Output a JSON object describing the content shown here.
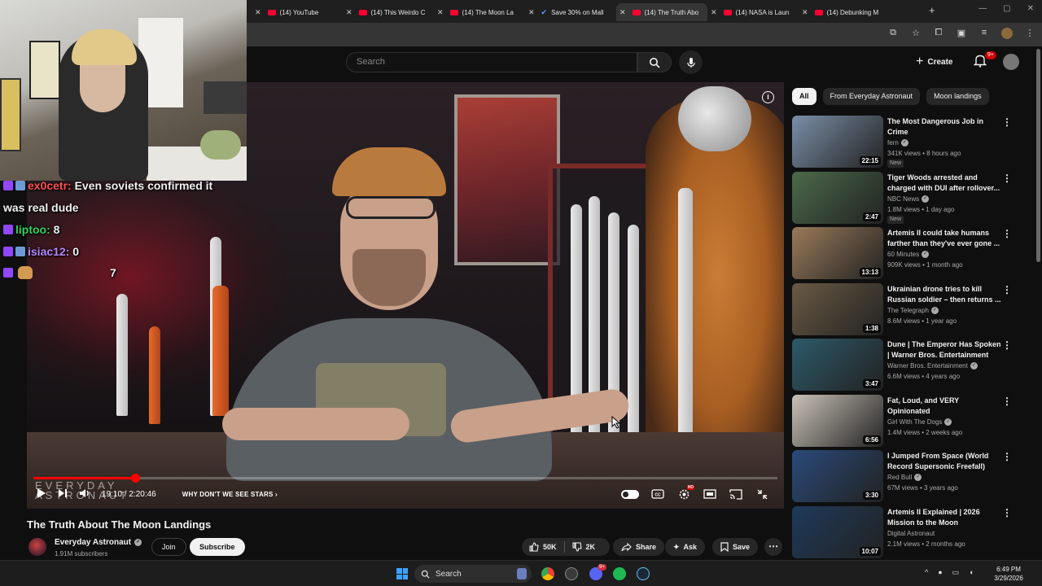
{
  "browser": {
    "tabs": [
      {
        "label": "(14) YouTube",
        "icon": "youtube-favicon",
        "active": false
      },
      {
        "label": "(14) This Weirdo C",
        "icon": "youtube-favicon",
        "active": false
      },
      {
        "label": "(14) The Moon La",
        "icon": "youtube-favicon",
        "active": false
      },
      {
        "label": "Save 30% on Mall",
        "icon": "steam-favicon",
        "active": false
      },
      {
        "label": "(14) The Truth Abo",
        "icon": "youtube-favicon",
        "active": true
      },
      {
        "label": "(14) NASA is Laun",
        "icon": "youtube-favicon",
        "active": false
      },
      {
        "label": "(14) Debunking M",
        "icon": "youtube-favicon",
        "active": false
      }
    ]
  },
  "youtube": {
    "search_placeholder": "Search",
    "create_label": "Create",
    "notification_count": "9+"
  },
  "stream_chat": [
    {
      "user": "ex0cetr:",
      "message": "Even soviets confirmed it",
      "continuation": "was real dude",
      "color": "#ff4f4f"
    },
    {
      "user": "liptoo:",
      "message": "8",
      "color": "#2fd25b"
    },
    {
      "user": "isiac12:",
      "message": "0",
      "color": "#b589ff"
    },
    {
      "user": "",
      "message": "7",
      "emote": "emote-face"
    }
  ],
  "player": {
    "watermark_line1": "EVERYDAY",
    "watermark_line2": "ASTRONAUT",
    "time": "19:10 / 2:20:46",
    "chapter": "WHY DON'T WE SEE STARS",
    "progress_fraction": 0.137,
    "settings_badge": "HD"
  },
  "video": {
    "title": "The Truth About The Moon Landings",
    "channel": "Everyday Astronaut",
    "subscribers": "1.91M subscribers",
    "join_label": "Join",
    "subscribe_label": "Subscribe",
    "likes": "50K",
    "dislikes": "2K",
    "share_label": "Share",
    "ask_label": "Ask",
    "save_label": "Save"
  },
  "sidebar": {
    "chips": [
      "All",
      "From Everyday Astronaut",
      "Moon landings"
    ],
    "items": [
      {
        "title": "The Most Dangerous Job in Crime",
        "channel": "fern",
        "verified": true,
        "meta": "341K views • 8 hours ago",
        "badge": "New",
        "duration": "22:15",
        "thumb": "#7a8fa8"
      },
      {
        "title": "Tiger Woods arrested and charged with DUI after rollover...",
        "channel": "NBC News",
        "verified": true,
        "meta": "1.8M views • 1 day ago",
        "badge": "New",
        "duration": "2:47",
        "thumb": "#4b6a4a"
      },
      {
        "title": "Artemis II could take humans farther than they've ever gone ...",
        "channel": "60 Minutes",
        "verified": true,
        "meta": "909K views • 1 month ago",
        "badge": "",
        "duration": "13:13",
        "thumb": "#9a7a5a"
      },
      {
        "title": "Ukrainian drone tries to kill Russian soldier – then returns ...",
        "channel": "The Telegraph",
        "verified": true,
        "meta": "8.6M views • 1 year ago",
        "badge": "",
        "duration": "1:38",
        "thumb": "#6a5a44"
      },
      {
        "title": "Dune | The Emperor Has Spoken | Warner Bros. Entertainment",
        "channel": "Warner Bros. Entertainment",
        "verified": true,
        "meta": "6.6M views • 4 years ago",
        "badge": "",
        "duration": "3:47",
        "thumb": "#2d5a6a"
      },
      {
        "title": "Fat, Loud, and VERY Opinionated",
        "channel": "Girl With The Dogs",
        "verified": true,
        "meta": "1.4M views • 2 weeks ago",
        "badge": "",
        "duration": "6:56",
        "thumb": "#c9c2b8"
      },
      {
        "title": "I Jumped From Space (World Record Supersonic Freefall)",
        "channel": "Red Bull",
        "verified": true,
        "meta": "67M views • 3 years ago",
        "badge": "",
        "duration": "3:30",
        "thumb": "#2a4a7a"
      },
      {
        "title": "Artemis II Explained | 2026 Mission to the Moon",
        "channel": "Digital Astronaut",
        "verified": false,
        "meta": "2.1M views • 2 months ago",
        "badge": "",
        "duration": "10:07",
        "thumb": "#1e3a5a"
      }
    ]
  },
  "taskbar": {
    "search_label": "Search",
    "discord_badge": "9+",
    "time": "6:49 PM",
    "date": "3/29/2026"
  }
}
